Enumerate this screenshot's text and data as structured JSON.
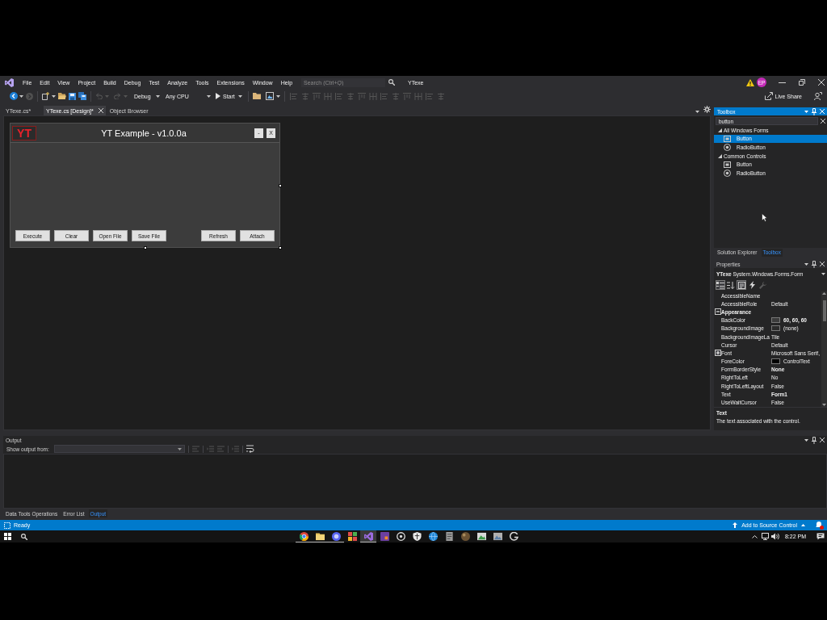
{
  "title_bar": {
    "menus": [
      "File",
      "Edit",
      "View",
      "Project",
      "Build",
      "Debug",
      "Test",
      "Analyze",
      "Tools",
      "Extensions",
      "Window",
      "Help"
    ],
    "search": {
      "placeholder": "Search (Ctrl+Q)"
    },
    "solution_name": "YTexe",
    "account_initials": "EP"
  },
  "toolbar": {
    "configuration": "Debug",
    "platform": "Any CPU",
    "start": "Start",
    "live_share": "Live Share"
  },
  "document_tabs": [
    {
      "label": "YTexe.cs*",
      "selected": false
    },
    {
      "label": "YTexe.cs [Design]*",
      "selected": true
    },
    {
      "label": "Object Browser",
      "selected": false
    }
  ],
  "designer": {
    "form": {
      "logo": "YT",
      "title": "YT Example - v1.0.0a",
      "window_buttons": [
        "-",
        "X"
      ],
      "button_groups": [
        [
          "Execute",
          "Clear",
          "Open File",
          "Save File"
        ],
        [
          "Refresh",
          "Attach"
        ]
      ]
    }
  },
  "toolbox": {
    "title": "Toolbox",
    "search": {
      "value": "button"
    },
    "groups": [
      {
        "label": "All Windows Forms",
        "expanded": true,
        "children": [
          {
            "label": "Button",
            "kind": "button",
            "selected": true
          },
          {
            "label": "RadioButton",
            "kind": "radio",
            "selected": false
          }
        ]
      },
      {
        "label": "Common Controls",
        "expanded": true,
        "children": [
          {
            "label": "Button",
            "kind": "button",
            "selected": false
          },
          {
            "label": "RadioButton",
            "kind": "radio",
            "selected": false
          }
        ]
      }
    ]
  },
  "panel_tabs": [
    {
      "label": "Solution Explorer",
      "selected": false
    },
    {
      "label": "Toolbox",
      "selected": true
    }
  ],
  "properties": {
    "title": "Properties",
    "object": "**YTexe** System.Windows.Forms.Form",
    "view_buttons": [
      {
        "kind": "categorized",
        "selected": true,
        "disabled": false
      },
      {
        "kind": "alphabetical",
        "selected": false,
        "disabled": false
      },
      {
        "kind": "properties",
        "selected": true,
        "disabled": false
      },
      {
        "kind": "events",
        "selected": false,
        "disabled": false
      },
      {
        "kind": "property_pages",
        "selected": false,
        "disabled": true
      }
    ],
    "rows": [
      {
        "kind": "property",
        "name": "AccessibleName"
      },
      {
        "kind": "property",
        "name": "AccessibleRole",
        "value": "Default",
        "modified": false
      },
      {
        "kind": "category",
        "label": "Appearance",
        "expanded": true,
        "children": [
          {
            "kind": "color",
            "name": "BackColor",
            "value": "60, 60, 60",
            "color": "#3c3c3c",
            "modified": true
          },
          {
            "kind": "image",
            "name": "BackgroundImage",
            "value": "(none)",
            "modified": false
          },
          {
            "kind": "property",
            "name": "BackgroundImageLa",
            "value": "Tile",
            "modified": false
          },
          {
            "kind": "property",
            "name": "Cursor",
            "value": "Default",
            "modified": false
          },
          {
            "kind": "expandable",
            "name": "Font",
            "value": "Microsoft Sans Serif,",
            "expanded": false,
            "modified": false
          },
          {
            "kind": "color",
            "name": "ForeColor",
            "value": "ControlText",
            "color": "#000000",
            "modified": false
          },
          {
            "kind": "property",
            "name": "FormBorderStyle",
            "value": "None",
            "modified": true
          },
          {
            "kind": "property",
            "name": "RightToLeft",
            "value": "No",
            "modified": false
          },
          {
            "kind": "property",
            "name": "RightToLeftLayout",
            "value": "False",
            "modified": false
          },
          {
            "kind": "property",
            "name": "Text",
            "value": "Form1",
            "modified": true
          },
          {
            "kind": "property",
            "name": "UseWaitCursor",
            "value": "False",
            "modified": false
          }
        ]
      }
    ],
    "description": {
      "title": "Text",
      "text": "The text associated with the control."
    }
  },
  "output": {
    "title": "Output",
    "source_label": "Show output from:",
    "tabs": [
      {
        "label": "Data Tools Operations",
        "selected": false
      },
      {
        "label": "Error List",
        "selected": false
      },
      {
        "label": "Output",
        "selected": true
      }
    ]
  },
  "status_bar": {
    "status": "Ready",
    "source_control": "Add to Source Control"
  },
  "taskbar": {
    "apps": [
      {
        "kind": "ring",
        "open": true,
        "active": false
      },
      {
        "kind": "folder",
        "open": true,
        "active": false
      },
      {
        "kind": "orb",
        "open": true,
        "active": false
      },
      {
        "kind": "grid",
        "open": false,
        "active": false
      },
      {
        "kind": "studio",
        "open": true,
        "active": true
      },
      {
        "kind": "square",
        "open": false,
        "active": false
      },
      {
        "kind": "circle",
        "open": false,
        "active": false
      },
      {
        "kind": "shield",
        "open": false,
        "active": false
      },
      {
        "kind": "globe",
        "open": false,
        "active": false
      },
      {
        "kind": "document",
        "open": false,
        "active": false
      },
      {
        "kind": "sphere",
        "open": false,
        "active": false
      },
      {
        "kind": "photo",
        "open": false,
        "active": false
      },
      {
        "kind": "picture",
        "open": false,
        "active": false
      },
      {
        "kind": "arc",
        "open": false,
        "active": false
      }
    ],
    "time": "8:22 PM"
  }
}
